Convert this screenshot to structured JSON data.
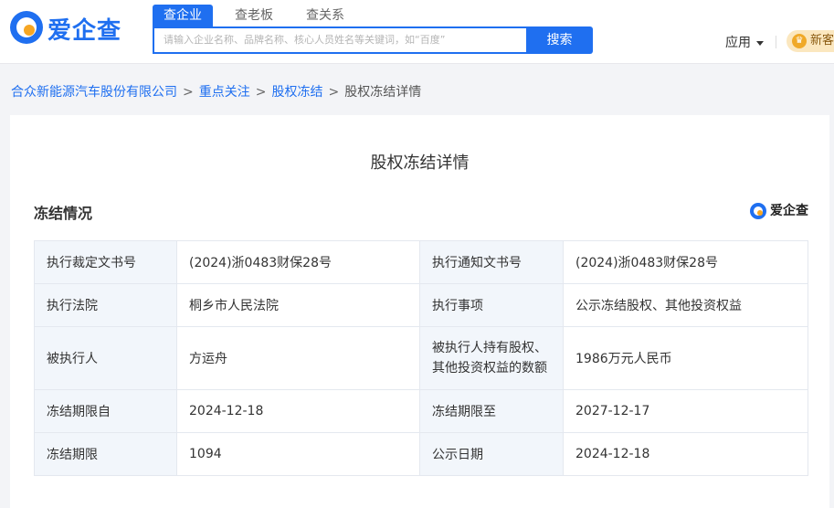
{
  "header": {
    "logo_text": "爱企查",
    "tabs": [
      "查企业",
      "查老板",
      "查关系"
    ],
    "search_placeholder": "请输入企业名称、品牌名称、核心人员姓名等关键词，如“百度”",
    "search_button": "搜索",
    "app_menu": "应用",
    "vip_badge": "新客"
  },
  "breadcrumb": {
    "items": [
      "合众新能源汽车股份有限公司",
      "重点关注",
      "股权冻结"
    ],
    "separator": ">",
    "current": "股权冻结详情"
  },
  "page": {
    "title": "股权冻结详情",
    "section_title": "冻结情况",
    "watermark_logo": "爱企查"
  },
  "table": {
    "rows": [
      [
        "执行裁定文书号",
        "(2024)浙0483财保28号",
        "执行通知文书号",
        "(2024)浙0483财保28号"
      ],
      [
        "执行法院",
        "桐乡市人民法院",
        "执行事项",
        "公示冻结股权、其他投资权益"
      ],
      [
        "被执行人",
        "方运舟",
        "被执行人持有股权、其他投资权益的数额",
        "1986万元人民币"
      ],
      [
        "冻结期限自",
        "2024-12-18",
        "冻结期限至",
        "2027-12-17"
      ],
      [
        "冻结期限",
        "1094",
        "公示日期",
        "2024-12-18"
      ]
    ],
    "wrapped_label_lines": [
      "被执行人持有股权、",
      "其他投资权益的数额"
    ]
  },
  "colors": {
    "brand": "#1f6ff0",
    "accent": "#f6a623",
    "label_bg": "#f2f6fb",
    "page_bg": "#f3f4f7"
  }
}
